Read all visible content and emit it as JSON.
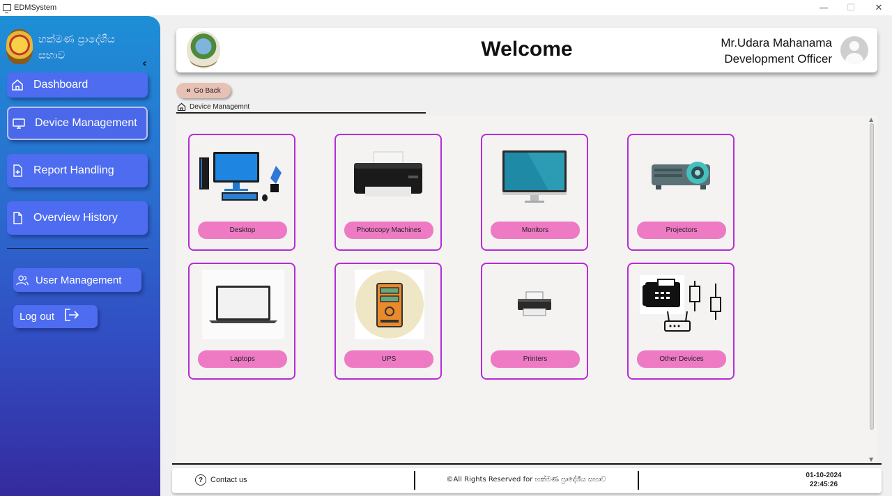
{
  "window": {
    "title": "EDMSystem",
    "controls": {
      "minimize": "—",
      "maximize": "☐",
      "close": "✕"
    }
  },
  "sidebar": {
    "org_name": "හක්මණ ප්‍රාදේශීය සභාව",
    "collapse_icon": "chevron-left-icon",
    "items": [
      {
        "label": "Dashboard",
        "icon": "home-icon"
      },
      {
        "label": "Device Management",
        "icon": "monitor-icon",
        "selected": true
      },
      {
        "label": "Report Handling",
        "icon": "file-plus-icon"
      },
      {
        "label": "Overview History",
        "icon": "file-icon"
      }
    ],
    "user_management": {
      "label": "User Management",
      "icon": "users-icon"
    },
    "logout": {
      "label": "Log out",
      "icon": "logout-icon"
    }
  },
  "header": {
    "title": "Welcome",
    "user_name": "Mr.Udara Mahanama",
    "user_role": "Development Officer"
  },
  "go_back": {
    "label": "Go Back"
  },
  "breadcrumb": {
    "label": "Device Managemnt"
  },
  "devices": [
    {
      "label": "Desktop",
      "icon": "desktop-computer-icon"
    },
    {
      "label": "Photocopy Machines",
      "icon": "photocopy-machine-icon"
    },
    {
      "label": "Monitors",
      "icon": "monitor-icon"
    },
    {
      "label": "Projectors",
      "icon": "projector-icon"
    },
    {
      "label": "Laptops",
      "icon": "laptop-icon"
    },
    {
      "label": "UPS",
      "icon": "ups-icon"
    },
    {
      "label": "Printers",
      "icon": "printer-icon"
    },
    {
      "label": "Other Devices",
      "icon": "other-devices-icon"
    }
  ],
  "footer": {
    "contact": "Contact us",
    "copyright": "©All Rights Reserved for හක්මණ ප්‍රාදේශීය සභාව",
    "date": "01-10-2024",
    "time": "22:45:26"
  },
  "colors": {
    "sidebar_top": "#1d8fd6",
    "sidebar_bottom": "#352a9e",
    "nav_button": "#4d6cf0",
    "card_border": "#b72cd4",
    "card_pill": "#ee7ac4",
    "go_back": "#e8c1b5"
  }
}
